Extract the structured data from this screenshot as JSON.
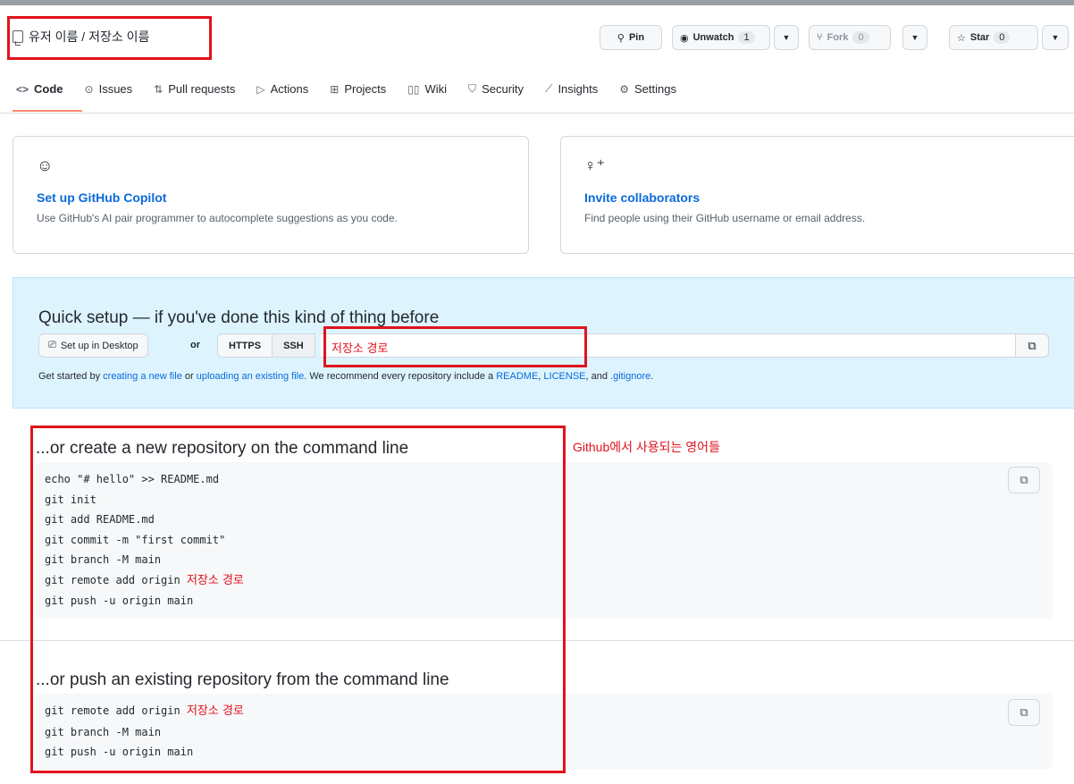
{
  "header": {
    "repo_title": "유저 이름 / 저장소 이름",
    "pin_label": "Pin",
    "unwatch_label": "Unwatch",
    "unwatch_count": "1",
    "fork_label": "Fork",
    "fork_count": "0",
    "star_label": "Star",
    "star_count": "0"
  },
  "nav": {
    "tabs": [
      {
        "label": "Code",
        "icon": "code-icon",
        "active": true
      },
      {
        "label": "Issues",
        "icon": "issue-icon"
      },
      {
        "label": "Pull requests",
        "icon": "pull-request-icon"
      },
      {
        "label": "Actions",
        "icon": "play-icon"
      },
      {
        "label": "Projects",
        "icon": "table-icon"
      },
      {
        "label": "Wiki",
        "icon": "book-icon"
      },
      {
        "label": "Security",
        "icon": "shield-icon"
      },
      {
        "label": "Insights",
        "icon": "graph-icon"
      },
      {
        "label": "Settings",
        "icon": "gear-icon"
      }
    ]
  },
  "cards": {
    "copilot": {
      "title": "Set up GitHub Copilot",
      "desc": "Use GitHub's AI pair programmer to autocomplete suggestions as you code.",
      "icon": "copilot-icon"
    },
    "invite": {
      "title": "Invite collaborators",
      "desc": "Find people using their GitHub username or email address.",
      "icon": "person-add-icon"
    }
  },
  "quick_setup": {
    "title": "Quick setup — if you've done this kind of thing before",
    "desktop_label": "Set up in Desktop",
    "or_label": "or",
    "https_label": "HTTPS",
    "ssh_label": "SSH",
    "url_value": "저장소 경로",
    "hint_prefix": "Get started by",
    "hint_link1": "creating a new file",
    "hint_or": "or",
    "hint_link2": "uploading an existing file",
    "hint_mid": ". We recommend every repository include a",
    "hint_readme": "README",
    "hint_license": "LICENSE",
    "hint_and": ", and",
    "hint_gitignore": ".gitignore",
    "hint_end": "."
  },
  "create_section": {
    "title": "...or create a new repository on the command line",
    "lines": [
      "echo \"# hello\" >> README.md",
      "git init",
      "git add README.md",
      "git commit -m \"first commit\"",
      "git branch -M main"
    ],
    "remote_prefix": "git remote add origin",
    "remote_value": "저장소 경로",
    "last_line": "git push -u origin main"
  },
  "push_section": {
    "title": "...or push an existing repository from the command line",
    "remote_prefix": "git remote add origin",
    "remote_value": "저장소 경로",
    "lines": [
      "git branch -M main",
      "git push -u origin main"
    ]
  },
  "annotation": "Github에서 사용되는 영어들",
  "colors": {
    "accent_blue": "#0969da",
    "annotation_red": "#e0131c",
    "quick_setup_bg": "#ddf4ff",
    "active_tab_underline": "#fd8c73"
  }
}
